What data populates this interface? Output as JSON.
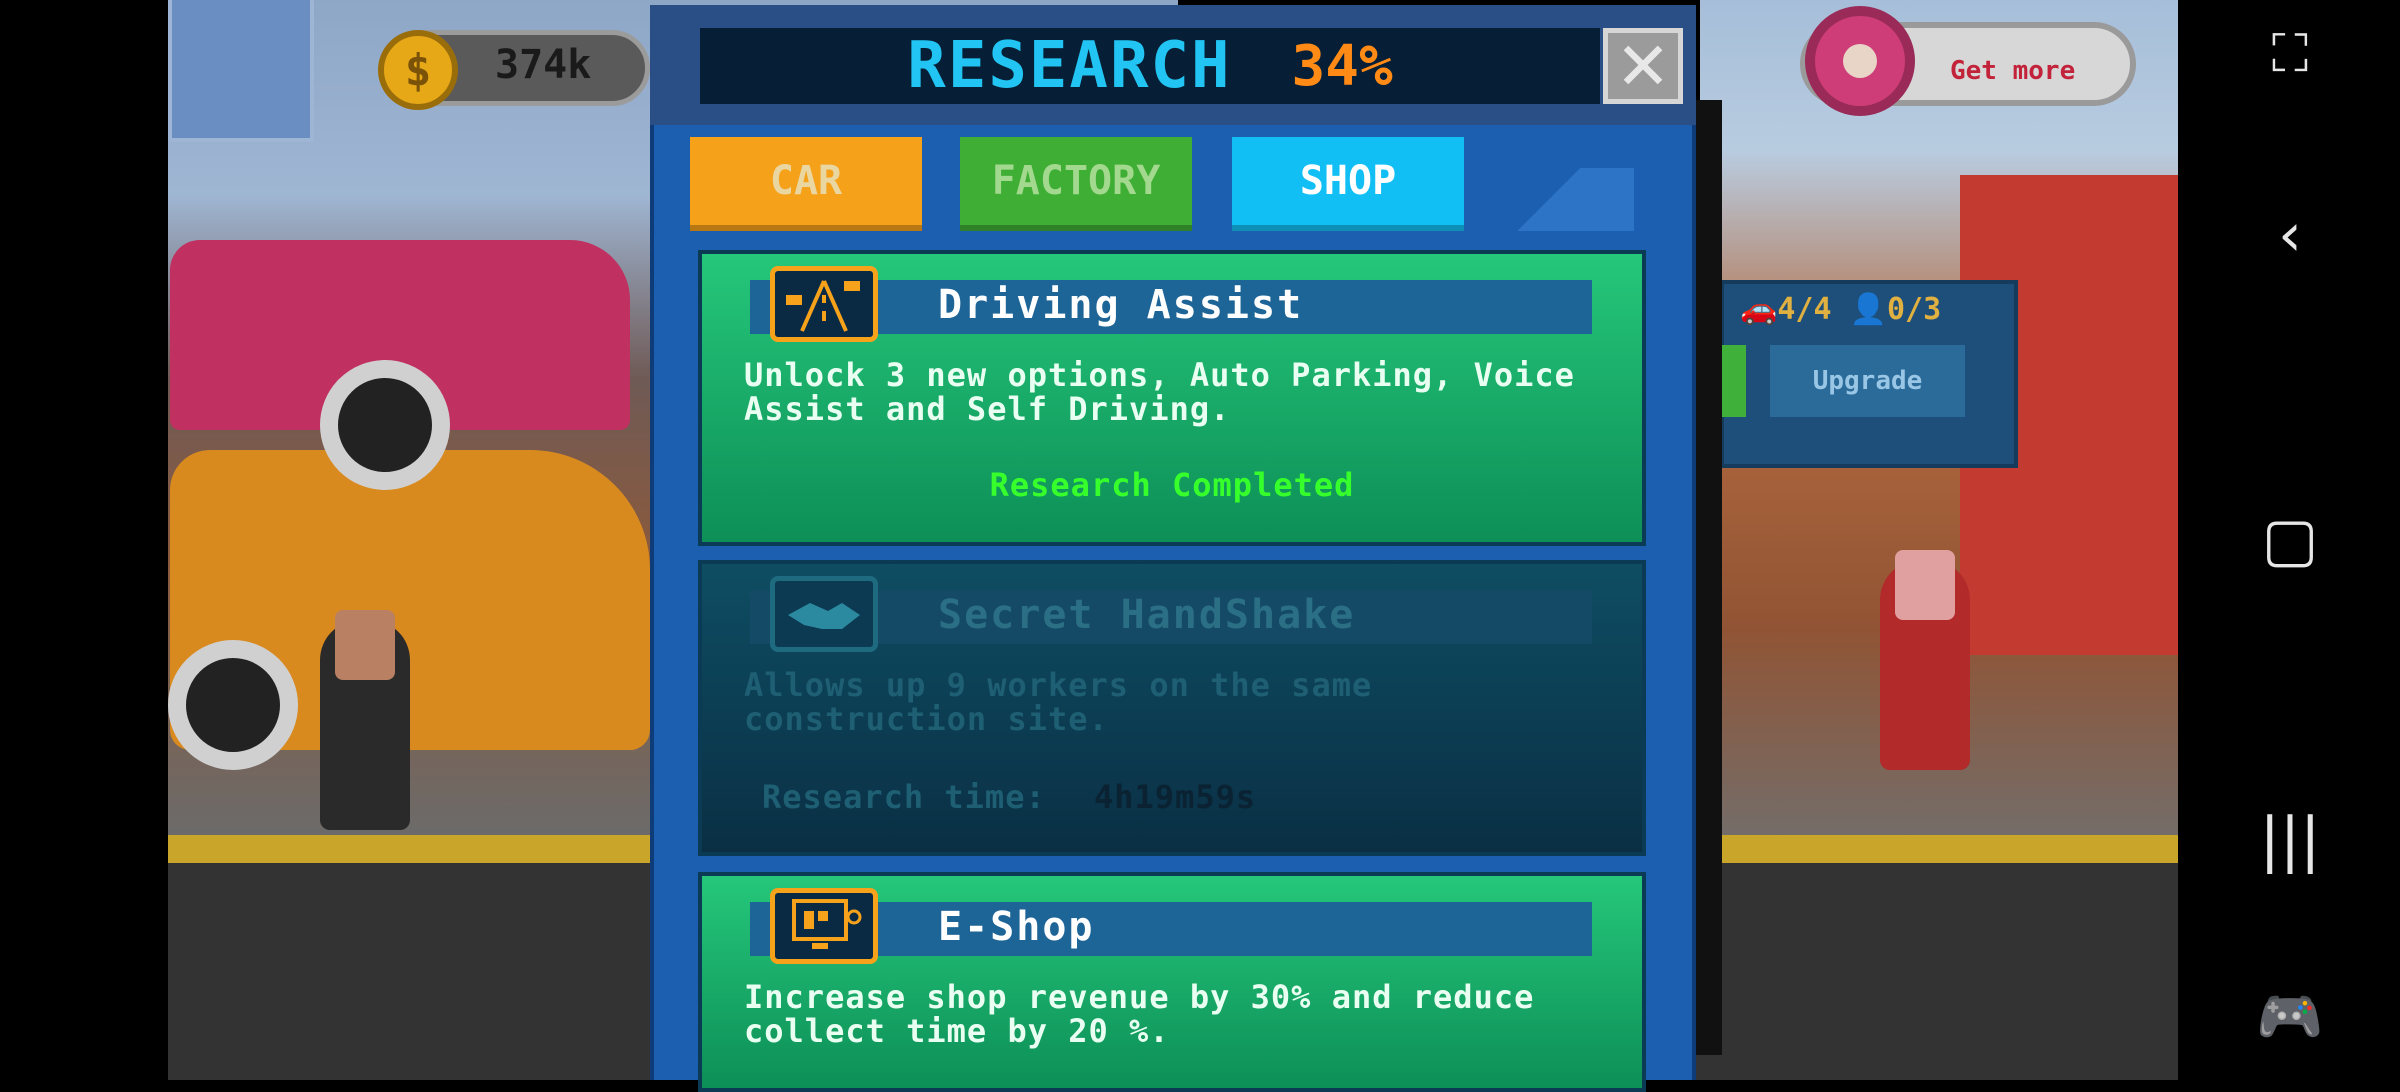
{
  "hud": {
    "coins": "374k",
    "get_more": "Get more"
  },
  "background": {
    "shop_workers": "4/4",
    "shop_slots": "0/3",
    "shop_upgrade": "Upgrade"
  },
  "research": {
    "title": "RESEARCH",
    "percent": "34%",
    "close_icon": "close-icon",
    "tabs": [
      {
        "label": "CAR",
        "color": "#f5a11a"
      },
      {
        "label": "FACTORY",
        "color": "#3fae34"
      },
      {
        "label": "SHOP",
        "color": "#12bff4"
      }
    ],
    "cards": [
      {
        "title": "Driving Assist",
        "icon": "road-icon",
        "description": "Unlock 3 new options, Auto Parking, Voice Assist and Self Driving.",
        "status": "Research Completed",
        "state": "completed"
      },
      {
        "title": "Secret HandShake",
        "icon": "handshake-icon",
        "description": "Allows up 9 workers on the same construction site.",
        "time_label": "Research time:",
        "time_value": "4h19m59s",
        "state": "locked"
      },
      {
        "title": "E-Shop",
        "icon": "computer-icon",
        "description": "Increase shop revenue by 30% and reduce collect time by 20 %.",
        "state": "available"
      }
    ]
  },
  "colors": {
    "title": "#21c4f2",
    "percent": "#ff8a16",
    "completed": "#36ff2b"
  }
}
